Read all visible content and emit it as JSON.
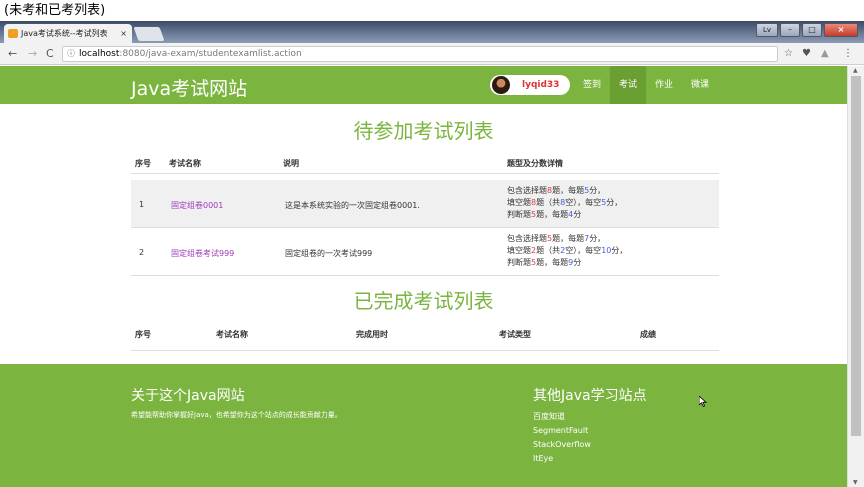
{
  "caption": "(未考和已考列表)",
  "browser": {
    "tab_title": "Java考试系统--考试列表",
    "tab_close": "×",
    "window_buttons": [
      "Lv",
      "–",
      "□",
      "×"
    ],
    "url_info_icon": "ⓘ",
    "url_host": "localhost",
    "url_rest": ":8080/java-exam/studentexamlist.action"
  },
  "nav": {
    "brand": "Java考试网站",
    "username": "lyqid33",
    "links": [
      "签到",
      "考试",
      "作业",
      "微课"
    ],
    "active_index": 1
  },
  "pending": {
    "title": "待参加考试列表",
    "headers": [
      "序号",
      "考试名称",
      "说明",
      "题型及分数详情"
    ],
    "rows": [
      {
        "index": "1",
        "name": "固定组卷0001",
        "desc": "这是本系统实验的一次固定组卷0001.",
        "line1": {
          "a": "包含选择题",
          "n1": "8",
          "b": "题，每题",
          "n2": "5",
          "c": "分，"
        },
        "line2": {
          "a": "填空题",
          "n1": "8",
          "b": "题（共",
          "n2": "8",
          "c": "空），每空",
          "n3": "5",
          "d": "分，"
        },
        "line3": {
          "a": "判断题",
          "n1": "5",
          "b": "题，每题",
          "n2": "4",
          "c": "分"
        }
      },
      {
        "index": "2",
        "name": "固定组卷考试999",
        "desc": "固定组卷的一次考试999",
        "line1": {
          "a": "包含选择题",
          "n1": "5",
          "b": "题，每题",
          "n2": "7",
          "c": "分，"
        },
        "line2": {
          "a": "填空题",
          "n1": "2",
          "b": "题（共",
          "n2": "2",
          "c": "空），每空",
          "n3": "10",
          "d": "分，"
        },
        "line3": {
          "a": "判断题",
          "n1": "5",
          "b": "题，每题",
          "n2": "9",
          "c": "分"
        }
      }
    ]
  },
  "completed": {
    "title": "已完成考试列表",
    "headers": [
      "序号",
      "考试名称",
      "完成用时",
      "考试类型",
      "成绩"
    ]
  },
  "footer": {
    "about_title": "关于这个Java网站",
    "about_text": "希望能帮助你掌握好Java，也希望你为这个站点的成长能贡献力量。",
    "other_title": "其他Java学习站点",
    "links": [
      "百度知道",
      "SegmentFault",
      "StackOverflow",
      "ItEye"
    ]
  },
  "colors": {
    "brand_green": "#7bb540",
    "exam_link_purple": "#a038b8",
    "number_blue": "#4060e0"
  }
}
